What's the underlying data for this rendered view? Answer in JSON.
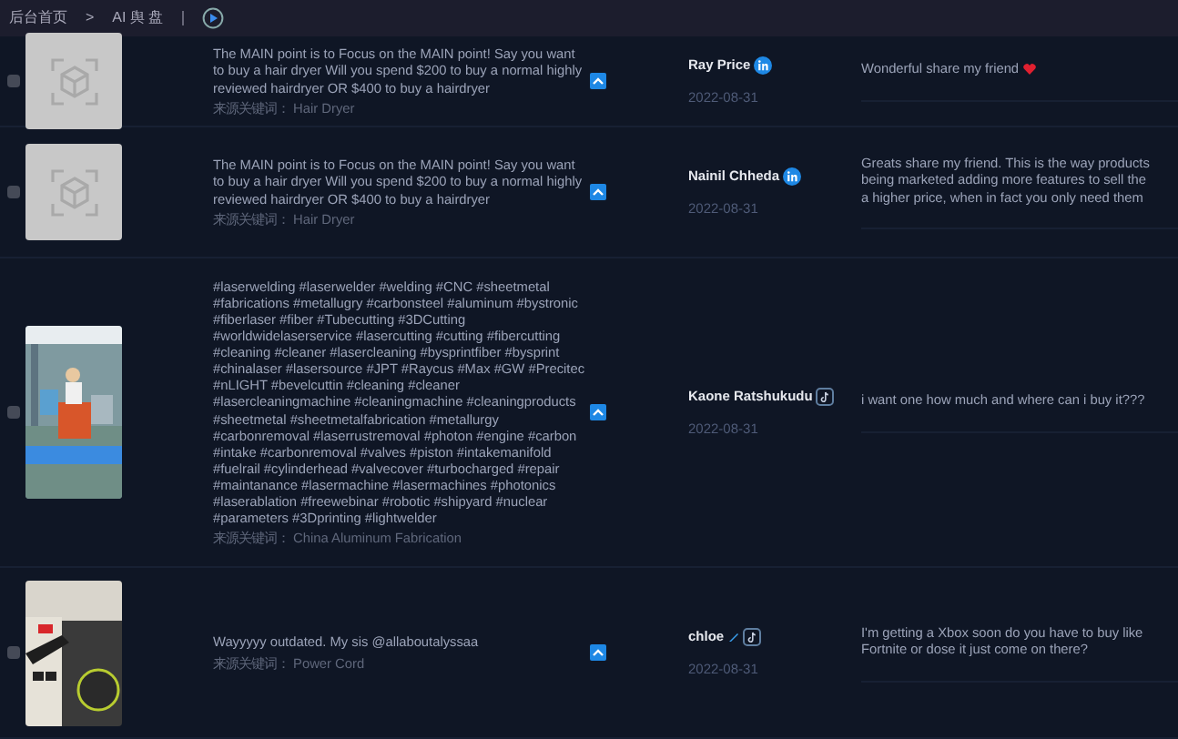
{
  "breadcrumb": [
    "后台首页",
    "AI 舆 盘"
  ],
  "separator": ">",
  "rows": [
    {
      "checked": false,
      "thumb": {
        "kind": "placeholder"
      },
      "text": "The MAIN point is to Focus on the MAIN point! Say you want to buy a hair dryer Will you spend $200 to buy a normal highly reviewed hairdryer OR $400 to buy a hairdryer",
      "source_label": "来源关键词：",
      "source": "Hair Dryer",
      "author": "Ray Price",
      "platform": {
        "kind": "linkedin"
      },
      "date": "2022-08-31",
      "comment": [
        "Wonderful share my friend"
      ],
      "comment_icon": {
        "kind": "heart"
      }
    },
    {
      "checked": false,
      "thumb": {
        "kind": "placeholder"
      },
      "text": "The MAIN point is to Focus on the MAIN point! Say you want to buy a hair dryer Will you spend $200 to buy a normal highly reviewed hairdryer OR $400 to buy a hairdryer",
      "source_label": "来源关键词：",
      "source": "Hair Dryer",
      "author": "Nainil Chheda",
      "platform": {
        "kind": "linkedin"
      },
      "date": "2022-08-31",
      "comment": [
        "Greats share my friend. This is the way products",
        "being marketed adding more features to sell the",
        "a higher price, when in fact you only need them"
      ]
    },
    {
      "checked": false,
      "thumb": {
        "kind": "picture"
      },
      "text": "#laserwelding #laserwelder #welding #CNC #sheetmetal #fabrications #metallugry #carbonsteel #aluminum #bystronic #fiberlaser #fiber #Tubecutting #3DCutting #worldwidelaserservice #lasercutting #cutting #fibercutting #cleaning #cleaner #lasercleaning #bysprintfiber #bysprint #chinalaser #lasersource #JPT #Raycus #Max #GW #Precitec #nLIGHT #bevelcuttin #cleaning #cleaner #lasercleaningmachine #cleaningmachine #cleaningproducts #sheetmetal #sheetmetalfabrication #metallurgy #carbonremoval #laserrustremoval #photon #engine #carbon #intake #carbonremoval #valves #piston #intakemanifold #fuelrail #cylinderhead #valvecover #turbocharged #repair #maintanance #lasermachine #lasermachines #photonics #laserablation #freewebinar #robotic #shipyard #nuclear #parameters #3Dprinting #lightwelder",
      "source_label": "来源关键词：",
      "source": "China Aluminum Fabrication",
      "author": "Kaone Ratshukudu",
      "platform": {
        "kind": "tiktok"
      },
      "date": "2022-08-31",
      "comment": [
        "i want one how much and where can i buy it???"
      ]
    },
    {
      "checked": false,
      "thumb": {
        "kind": "picture"
      },
      "text": "Wayyyyy outdated. My sis @allaboutalyssaa",
      "source_label": "来源关键词：",
      "source": "Power Cord",
      "author": "chloe",
      "author_icon": {
        "kind": "pen"
      },
      "platform": {
        "kind": "tiktok"
      },
      "date": "2022-08-31",
      "comment": [
        "I'm getting a Xbox soon do you have to buy like",
        "Fortnite or dose it just come on there?"
      ]
    }
  ]
}
